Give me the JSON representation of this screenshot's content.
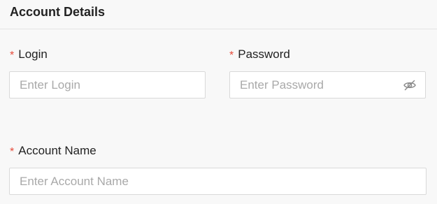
{
  "section": {
    "title": "Account Details"
  },
  "fields": {
    "required_marker": "*",
    "login": {
      "label": "Login",
      "placeholder": "Enter Login",
      "value": ""
    },
    "password": {
      "label": "Password",
      "placeholder": "Enter Password",
      "value": "",
      "toggle_icon": "eye-slash-icon"
    },
    "account_name": {
      "label": "Account Name",
      "placeholder": "Enter Account Name",
      "value": ""
    }
  },
  "colors": {
    "required_marker": "#e74c3c",
    "placeholder": "#a9a9a9",
    "border": "#d9d9d9",
    "background": "#f8f8f8"
  }
}
